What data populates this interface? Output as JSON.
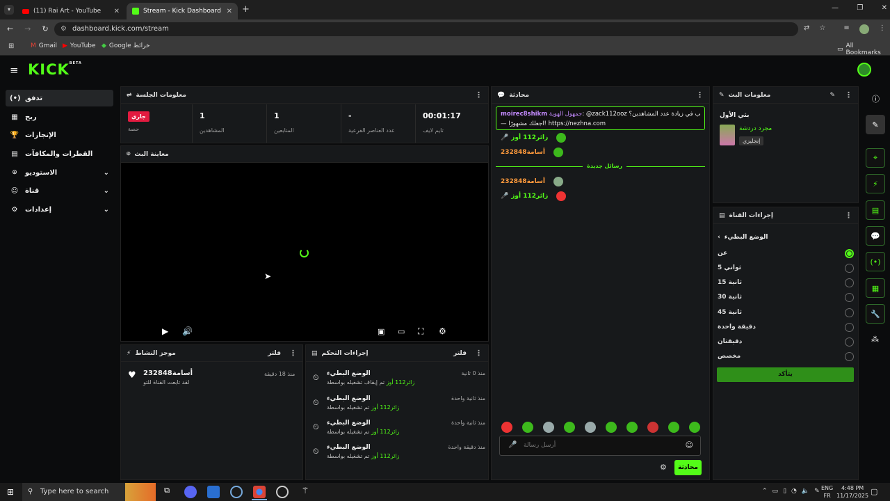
{
  "browser": {
    "tabs": [
      {
        "title": "(11) Rai Art - YouTube"
      },
      {
        "title": "Stream - Kick Dashboard"
      }
    ],
    "url": "dashboard.kick.com/stream",
    "bookmarks": [
      "Gmail",
      "YouTube",
      "Google خرائط"
    ],
    "all_bookmarks": "All Bookmarks"
  },
  "site": {
    "logo": "KICK",
    "logo_sup": "BETA"
  },
  "nav": [
    {
      "label": "تدفق",
      "icon": "(•)"
    },
    {
      "label": "ربح",
      "icon": "▦"
    },
    {
      "label": "الإنجازات",
      "icon": "🏆"
    },
    {
      "label": "القطرات والمكافآت",
      "icon": "▤"
    },
    {
      "label": "الاستوديو",
      "icon": "⌾"
    },
    {
      "label": "قناة",
      "icon": "☺"
    },
    {
      "label": "إعدادات",
      "icon": "⚙"
    }
  ],
  "session": {
    "title": "معلومات الجلسة",
    "status_badge": "جاري",
    "status_label": "حصة",
    "stats": [
      {
        "value": "1",
        "label": "المشاهدين"
      },
      {
        "value": "1",
        "label": "المتابعين"
      },
      {
        "value": "-",
        "label": "عدد العناصر الفرعية"
      },
      {
        "value": "00:01:17",
        "label": "تايم لايف"
      }
    ]
  },
  "preview": {
    "title": "معاينة البث"
  },
  "activity": {
    "title": "موجز النشاط",
    "filter": "فلتر",
    "items": [
      {
        "user": "أسامة232848",
        "text": "لقد تابعت القناة للتو",
        "time": "منذ 18 دقيقة"
      }
    ]
  },
  "modlog": {
    "title": "إجراءات التحكم",
    "filter": "فلتر",
    "items": [
      {
        "title": "الوضع البطيء",
        "by": "زائر112 أوز",
        "desc": "تم إيقاف تشغيله بواسطة",
        "time": "منذ 0 ثانية"
      },
      {
        "title": "الوضع البطيء",
        "by": "زائر112 أوز",
        "desc": "تم تشغيله بواسطة",
        "time": "منذ ثانية واحدة"
      },
      {
        "title": "الوضع البطيء",
        "by": "زائر112 أوز",
        "desc": "تم تشغيله بواسطة",
        "time": "منذ ثانية واحدة"
      },
      {
        "title": "الوضع البطيء",
        "by": "زائر112 أوز",
        "desc": "تم تشغيله بواسطة",
        "time": "منذ دقيقة واحدة"
      }
    ]
  },
  "chat": {
    "title": "محادثة",
    "pinned": {
      "user": "moirec8shikm",
      "handle": "جمهول الهوية",
      "mention": "@zack112ooz",
      "text": "هل ترغب في زيادة عدد المشاهدين؟",
      "link_text": "— اجعلك مشهورًا! https://nezhna.com"
    },
    "messages": [
      {
        "user": "زائر112 أوز",
        "text": ""
      },
      {
        "user": "أسامة232848",
        "text": ""
      }
    ],
    "divider": "رسائل جديدة",
    "new_messages": [
      {
        "user": "أسامة232848",
        "text": ""
      },
      {
        "user": "زائر112 أوز",
        "text": ""
      }
    ],
    "input_placeholder": "أرسل رسالة",
    "send_label": "محادثة"
  },
  "stream_info": {
    "title": "معلومات البث",
    "stream_title": "بثي الأول",
    "category": "مجرد دردشة",
    "language": "إنجليزي"
  },
  "channel_actions": {
    "title": "إجراءات القناة",
    "submenu": "الوضع البطيء",
    "options": [
      "عن",
      "5 ثواني",
      "15 ثانية",
      "30 ثانية",
      "45 ثانية",
      "دقيقة واحدة",
      "دقيقتان",
      "مخصص"
    ],
    "selected_index": 0,
    "confirm": "يتأكد"
  },
  "taskbar": {
    "search_placeholder": "Type here to search",
    "lang1": "ENG",
    "lang2": "FR",
    "time": "4:48 PM",
    "date": "11/17/2025"
  },
  "colors": {
    "accent": "#53fc18",
    "live": "#e21b40",
    "panel": "#17191b"
  }
}
